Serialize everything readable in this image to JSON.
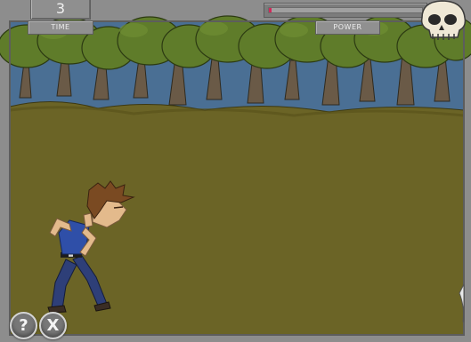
{
  "hud": {
    "time_value": "3",
    "time_label": "TIME",
    "power_label": "POWER",
    "power_level": 0.02
  },
  "controls": {
    "help_label": "?",
    "close_label": "X"
  },
  "colors": {
    "frame": "#8d8d8d",
    "grass": "#6b6426",
    "sky": "#4a6f94",
    "foliage": "#5f7c2a",
    "trunk": "#6a5a47",
    "power_fill": "#d2285a"
  },
  "icons": {
    "top_right": "skull-icon",
    "help": "question-mark-icon",
    "close": "x-icon"
  },
  "character": {
    "description_icon": "running-man-character"
  }
}
